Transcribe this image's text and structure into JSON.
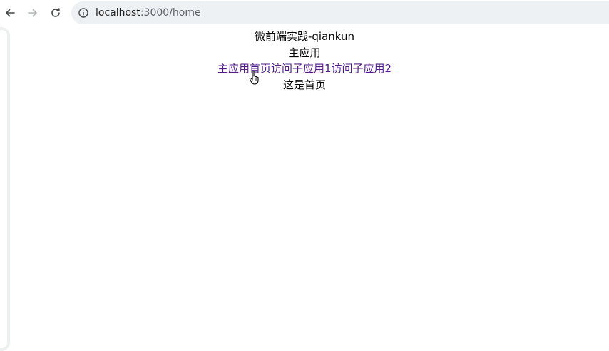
{
  "browser": {
    "url_host": "localhost",
    "url_path": ":3000/home"
  },
  "page": {
    "title": "微前端实践-qiankun",
    "main_app_label": "主应用",
    "links": [
      {
        "label": "主应用首页"
      },
      {
        "label": "访问子应用1"
      },
      {
        "label": "访问子应用2"
      }
    ],
    "body_text": "这是首页"
  },
  "colors": {
    "visited_link": "#551a8b",
    "omnibox_bg": "#eef1f4"
  },
  "icons": [
    "back-arrow-icon",
    "forward-arrow-icon",
    "reload-icon",
    "info-icon",
    "hand-pointer-icon"
  ]
}
